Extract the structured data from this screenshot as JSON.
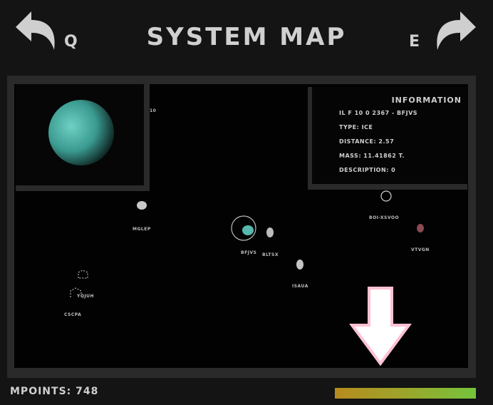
{
  "header": {
    "title": "SYSTEM MAP",
    "prev_key": "Q",
    "next_key": "E",
    "prev_icon": "back-arrow-icon",
    "next_icon": "forward-arrow-icon"
  },
  "planet_preview": {
    "label_fragment": "10",
    "color": "#3fa8a0"
  },
  "information": {
    "title": "INFORMATION",
    "id_line": "IL F 10 0 2367 - BFJVS",
    "type": "TYPE: ICE",
    "distance": "DISTANCE: 2.57",
    "mass": "MASS: 11.41862 T.",
    "description": "DESCRIPTION: 0"
  },
  "bodies": [
    {
      "label": "MGLEP"
    },
    {
      "label": "BFJVS"
    },
    {
      "label": "BLTSX"
    },
    {
      "label": "ISAUA"
    },
    {
      "label": "BOI-XSVOO"
    },
    {
      "label": "VTVGN"
    },
    {
      "label": "YQJUH"
    },
    {
      "label": "CSCPA"
    }
  ],
  "footer": {
    "points": "MPOINTS: 748",
    "resource_bar_fill": 1.0
  },
  "colors": {
    "accent_arrow": "#ffc2d2",
    "bar_start": "#b78a1e",
    "bar_end": "#75c43b"
  }
}
